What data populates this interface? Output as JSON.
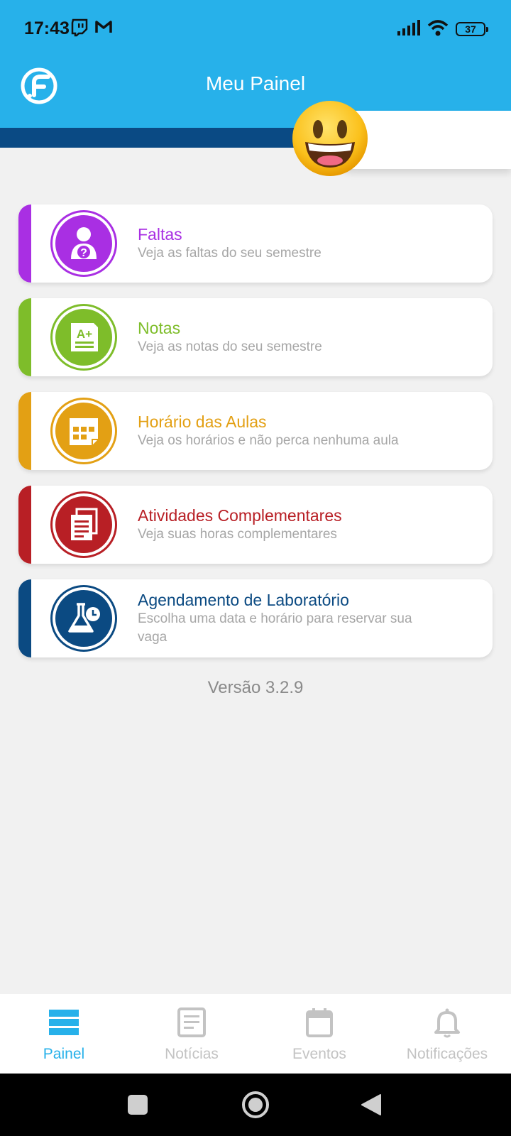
{
  "status_bar": {
    "time": "17:43",
    "notification_icons": [
      "twitch-icon",
      "gmail-icon"
    ],
    "battery_level": "37",
    "signal_icon": "cellular-signal-icon",
    "wifi_icon": "wifi-icon"
  },
  "header": {
    "title": "Meu Painel",
    "logo_icon": "app-logo-icon",
    "avatar_icon": "grinning-face-emoji"
  },
  "menu": {
    "items": [
      {
        "title": "Faltas",
        "subtitle": "Veja as faltas do seu semestre",
        "color": "#a92fe3",
        "icon": "absence-person-question-icon"
      },
      {
        "title": "Notas",
        "subtitle": "Veja as notas do seu semestre",
        "color": "#7ebd2a",
        "icon": "grades-a-plus-icon"
      },
      {
        "title": "Horário das Aulas",
        "subtitle": "Veja os horários e não perca nenhuma aula",
        "color": "#e3a014",
        "icon": "class-schedule-icon"
      },
      {
        "title": "Atividades Complementares",
        "subtitle": "Veja suas horas complementares",
        "color": "#b81f25",
        "icon": "documents-icon"
      },
      {
        "title": "Agendamento de Laboratório",
        "subtitle": "Escolha uma data e horário para reservar sua vaga",
        "color": "#0b4a82",
        "icon": "lab-flask-clock-icon"
      }
    ]
  },
  "version": "Versão 3.2.9",
  "bottom_nav": {
    "active_color": "#27b1ea",
    "inactive_color": "#c3c3c3",
    "items": [
      {
        "label": "Painel",
        "icon": "dashboard-icon",
        "active": true
      },
      {
        "label": "Notícias",
        "icon": "news-icon",
        "active": false
      },
      {
        "label": "Eventos",
        "icon": "calendar-icon",
        "active": false
      },
      {
        "label": "Notificações",
        "icon": "bell-icon",
        "active": false
      }
    ]
  },
  "system_nav": {
    "icons": [
      "recent-apps-icon",
      "home-icon",
      "back-icon"
    ]
  }
}
